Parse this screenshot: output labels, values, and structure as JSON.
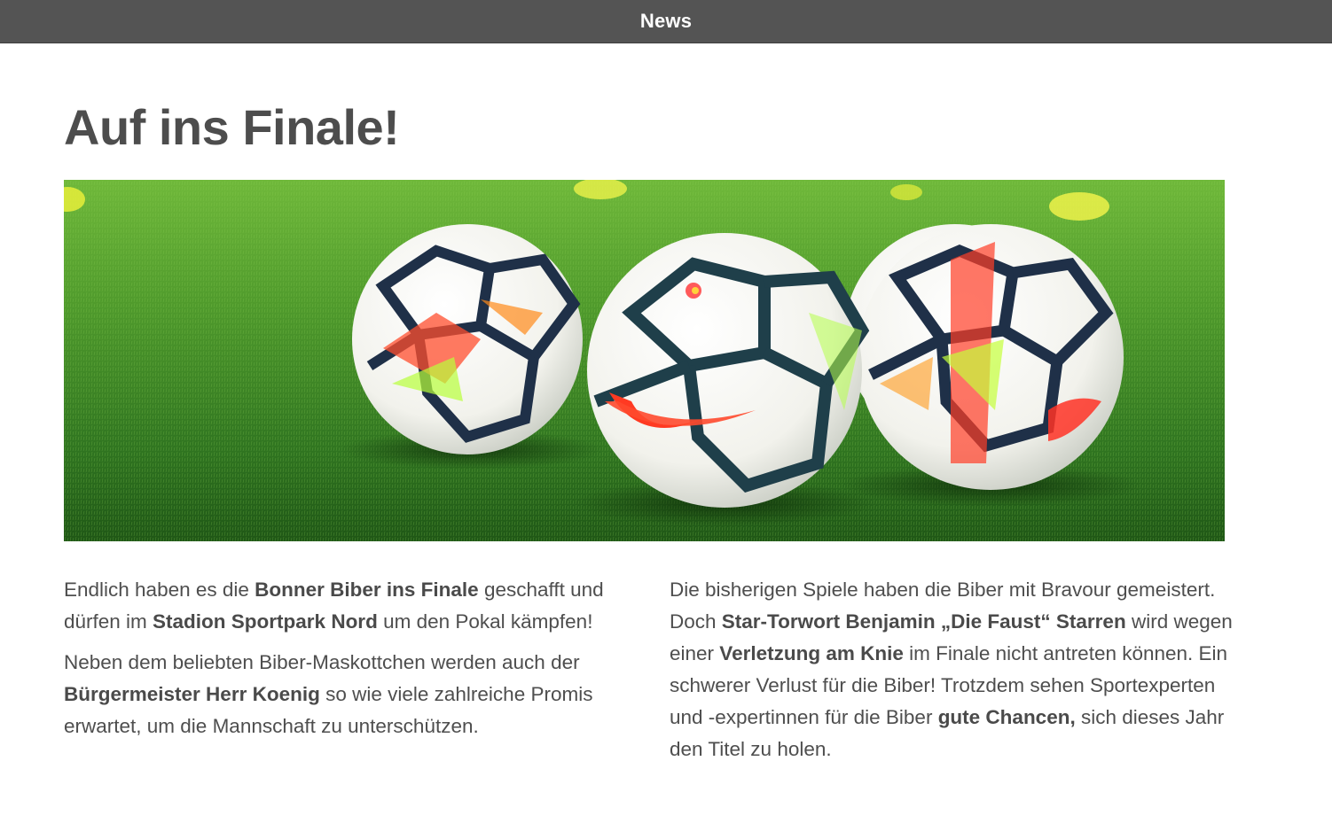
{
  "header": {
    "title": "News"
  },
  "article": {
    "title": "Auf ins Finale!",
    "image_alt": "Drei Fußbälle auf Kunstrasen",
    "left": {
      "p1": {
        "t1": "Endlich haben es die ",
        "b1": "Bonner Biber ins Finale",
        "t2": " geschafft und dürfen im ",
        "b2": "Stadion Sportpark Nord",
        "t3": " um den Pokal kämpfen!"
      },
      "p2": {
        "t1": "Neben dem beliebten Biber-Maskottchen werden auch der ",
        "b1": "Bürgermeister Herr Koenig",
        "t2": " so wie viele zahlreiche Promis erwartet, um die Mannschaft zu unterschützen."
      }
    },
    "right": {
      "p1": {
        "t1": "Die bisherigen Spiele haben die Biber mit Bravour ge­meistert. Doch ",
        "b1": "Star-Torwort Benjamin „Die Faust“ Starren",
        "t2": " wird wegen einer ",
        "b2": "Verletzung am Knie",
        "t3": " im Finale nicht antreten können. Ein schwerer Verlust für die Biber! Trotzdem sehen Sportexperten und -expertinnen für die Biber ",
        "b3": "gute Chancen,",
        "t4": " sich dieses Jahr den Titel zu holen."
      }
    }
  },
  "colors": {
    "header_bg": "#545454",
    "text": "#4e4e4e",
    "grass": "#3f8a2a"
  }
}
